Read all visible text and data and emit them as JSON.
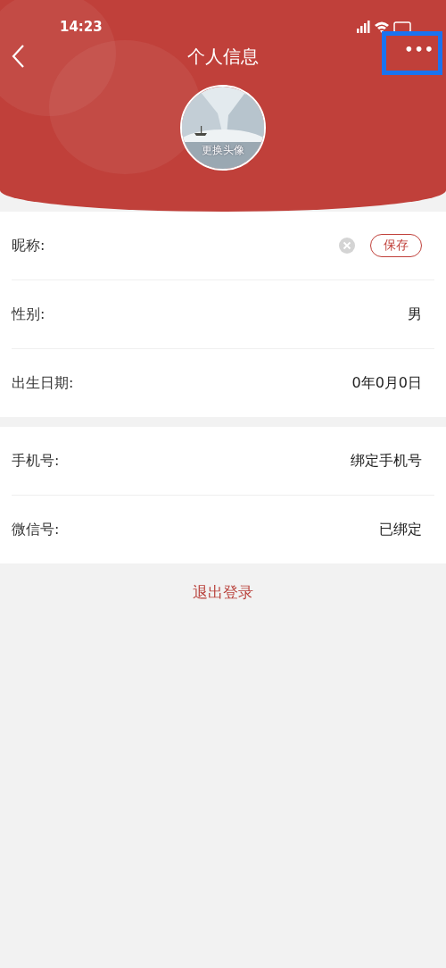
{
  "status_bar": {
    "time": "14:23"
  },
  "header": {
    "title": "个人信息",
    "more_button": {
      "label": "•••",
      "highlighted": true
    }
  },
  "avatar": {
    "caption": "更换头像"
  },
  "groups": [
    {
      "rows": [
        {
          "kind": "input",
          "label": "昵称:",
          "button": "保存"
        },
        {
          "kind": "value",
          "label": "性别:",
          "value": "男"
        },
        {
          "kind": "value",
          "label": "出生日期:",
          "value": "0年0月0日"
        }
      ]
    },
    {
      "rows": [
        {
          "kind": "value",
          "label": "手机号:",
          "value": "绑定手机号"
        },
        {
          "kind": "value",
          "label": "微信号:",
          "value": "已绑定"
        }
      ]
    }
  ],
  "logout": "退出登录"
}
